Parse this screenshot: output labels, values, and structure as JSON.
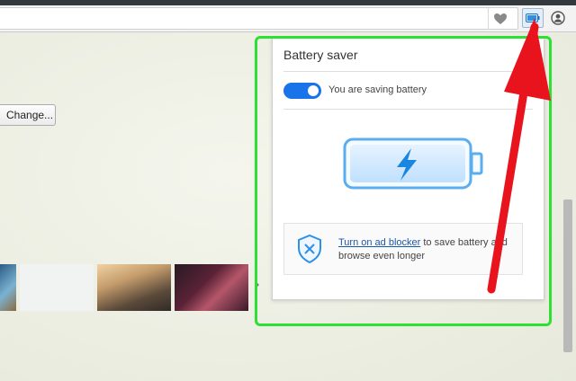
{
  "toolbar": {
    "icons": [
      "heart-icon",
      "battery-saver-icon",
      "profile-icon"
    ]
  },
  "settings": {
    "change_button": "Change..."
  },
  "popup": {
    "title": "Battery saver",
    "toggle_label": "You are saving battery",
    "toggle_on": true,
    "adblock_link": "Turn on ad blocker",
    "adblock_rest": " to save battery and browse even longer"
  },
  "colors": {
    "accent": "#1a73e8",
    "battery": "#2b90e8",
    "highlight_frame": "#2fe034",
    "arrow": "#e8131c"
  }
}
